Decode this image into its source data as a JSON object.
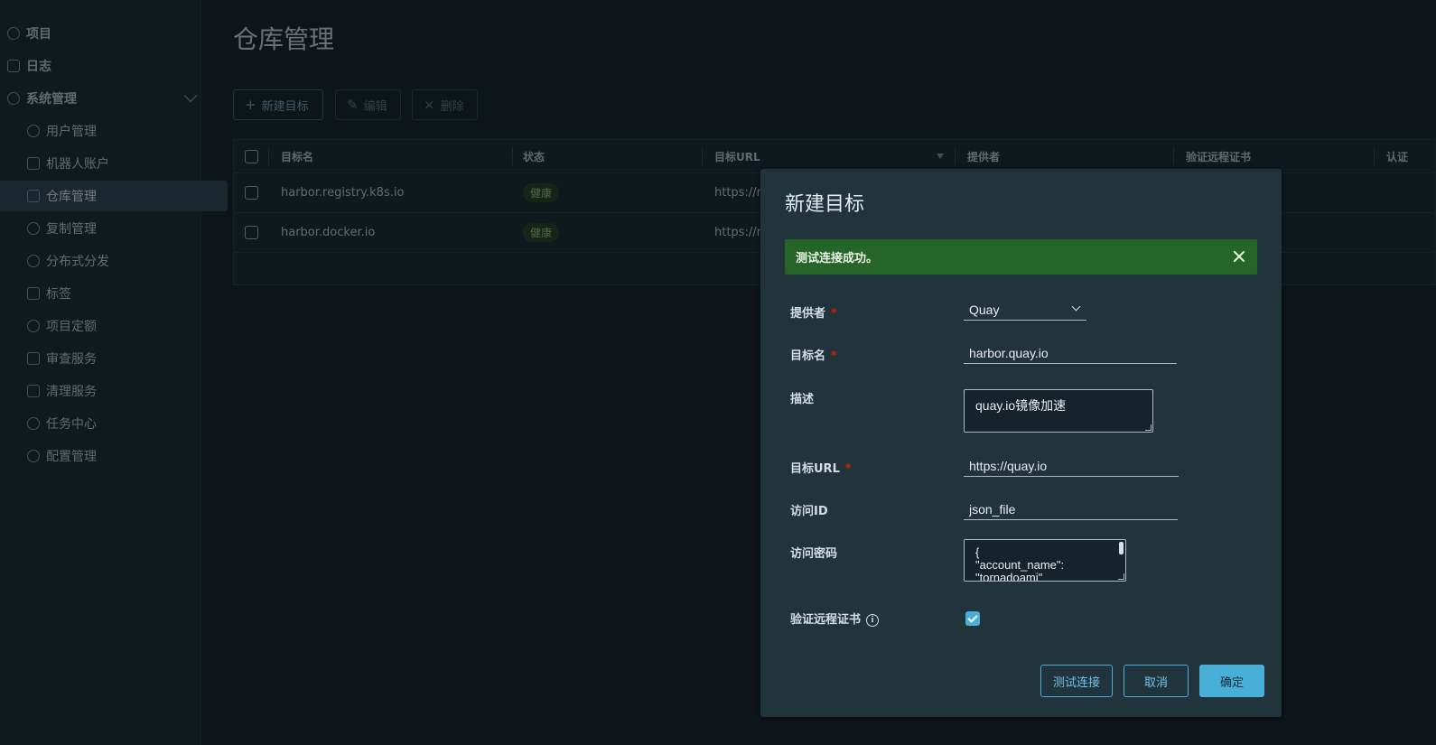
{
  "sidebar": {
    "items": [
      {
        "label": "项目",
        "icon": "projects-icon"
      },
      {
        "label": "日志",
        "icon": "logs-icon"
      },
      {
        "label": "系统管理",
        "icon": "admin-icon"
      }
    ],
    "sub_items": [
      {
        "label": "用户管理"
      },
      {
        "label": "机器人账户"
      },
      {
        "label": "仓库管理"
      },
      {
        "label": "复制管理"
      },
      {
        "label": "分布式分发"
      },
      {
        "label": "标签"
      },
      {
        "label": "项目定额"
      },
      {
        "label": "审查服务"
      },
      {
        "label": "清理服务"
      },
      {
        "label": "任务中心"
      },
      {
        "label": "配置管理"
      }
    ],
    "active": "仓库管理"
  },
  "main": {
    "title": "仓库管理",
    "toolbar": {
      "new_label": "新建目标",
      "edit_label": "编辑",
      "delete_label": "删除"
    },
    "table": {
      "headers": [
        "目标名",
        "状态",
        "目标URL",
        "提供者",
        "验证远程证书",
        "认证"
      ],
      "rows": [
        {
          "name": "harbor.registry.k8s.io",
          "status": "健康",
          "url": "https://r"
        },
        {
          "name": "harbor.docker.io",
          "status": "健康",
          "url": "https://r"
        }
      ]
    }
  },
  "modal": {
    "title": "新建目标",
    "alert": "测试连接成功。",
    "fields": {
      "provider_label": "提供者",
      "provider_value": "Quay",
      "name_label": "目标名",
      "name_value": "harbor.quay.io",
      "desc_label": "描述",
      "desc_value": "quay.io镜像加速",
      "url_label": "目标URL",
      "url_value": "https://quay.io",
      "access_id_label": "访问ID",
      "access_id_value": "json_file",
      "secret_label": "访问密码",
      "secret_lines": [
        "{",
        "\"account_name\":",
        "\"tornadoami\""
      ],
      "verify_label": "验证远程证书",
      "verify_checked": true,
      "required_mark": "*"
    },
    "buttons": {
      "test": "测试连接",
      "cancel": "取消",
      "ok": "确定"
    }
  },
  "colors": {
    "accent": "#49afd9",
    "success": "#266528",
    "required": "#c92100"
  }
}
